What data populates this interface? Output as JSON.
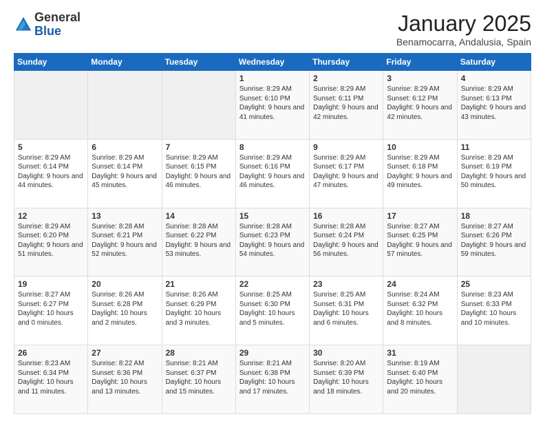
{
  "header": {
    "logo_general": "General",
    "logo_blue": "Blue",
    "month_title": "January 2025",
    "location": "Benamocarra, Andalusia, Spain"
  },
  "days_of_week": [
    "Sunday",
    "Monday",
    "Tuesday",
    "Wednesday",
    "Thursday",
    "Friday",
    "Saturday"
  ],
  "weeks": [
    [
      {
        "day": "",
        "text": ""
      },
      {
        "day": "",
        "text": ""
      },
      {
        "day": "",
        "text": ""
      },
      {
        "day": "1",
        "text": "Sunrise: 8:29 AM\nSunset: 6:10 PM\nDaylight: 9 hours\nand 41 minutes."
      },
      {
        "day": "2",
        "text": "Sunrise: 8:29 AM\nSunset: 6:11 PM\nDaylight: 9 hours\nand 42 minutes."
      },
      {
        "day": "3",
        "text": "Sunrise: 8:29 AM\nSunset: 6:12 PM\nDaylight: 9 hours\nand 42 minutes."
      },
      {
        "day": "4",
        "text": "Sunrise: 8:29 AM\nSunset: 6:13 PM\nDaylight: 9 hours\nand 43 minutes."
      }
    ],
    [
      {
        "day": "5",
        "text": "Sunrise: 8:29 AM\nSunset: 6:14 PM\nDaylight: 9 hours\nand 44 minutes."
      },
      {
        "day": "6",
        "text": "Sunrise: 8:29 AM\nSunset: 6:14 PM\nDaylight: 9 hours\nand 45 minutes."
      },
      {
        "day": "7",
        "text": "Sunrise: 8:29 AM\nSunset: 6:15 PM\nDaylight: 9 hours\nand 46 minutes."
      },
      {
        "day": "8",
        "text": "Sunrise: 8:29 AM\nSunset: 6:16 PM\nDaylight: 9 hours\nand 46 minutes."
      },
      {
        "day": "9",
        "text": "Sunrise: 8:29 AM\nSunset: 6:17 PM\nDaylight: 9 hours\nand 47 minutes."
      },
      {
        "day": "10",
        "text": "Sunrise: 8:29 AM\nSunset: 6:18 PM\nDaylight: 9 hours\nand 49 minutes."
      },
      {
        "day": "11",
        "text": "Sunrise: 8:29 AM\nSunset: 6:19 PM\nDaylight: 9 hours\nand 50 minutes."
      }
    ],
    [
      {
        "day": "12",
        "text": "Sunrise: 8:29 AM\nSunset: 6:20 PM\nDaylight: 9 hours\nand 51 minutes."
      },
      {
        "day": "13",
        "text": "Sunrise: 8:28 AM\nSunset: 6:21 PM\nDaylight: 9 hours\nand 52 minutes."
      },
      {
        "day": "14",
        "text": "Sunrise: 8:28 AM\nSunset: 6:22 PM\nDaylight: 9 hours\nand 53 minutes."
      },
      {
        "day": "15",
        "text": "Sunrise: 8:28 AM\nSunset: 6:23 PM\nDaylight: 9 hours\nand 54 minutes."
      },
      {
        "day": "16",
        "text": "Sunrise: 8:28 AM\nSunset: 6:24 PM\nDaylight: 9 hours\nand 56 minutes."
      },
      {
        "day": "17",
        "text": "Sunrise: 8:27 AM\nSunset: 6:25 PM\nDaylight: 9 hours\nand 57 minutes."
      },
      {
        "day": "18",
        "text": "Sunrise: 8:27 AM\nSunset: 6:26 PM\nDaylight: 9 hours\nand 59 minutes."
      }
    ],
    [
      {
        "day": "19",
        "text": "Sunrise: 8:27 AM\nSunset: 6:27 PM\nDaylight: 10 hours\nand 0 minutes."
      },
      {
        "day": "20",
        "text": "Sunrise: 8:26 AM\nSunset: 6:28 PM\nDaylight: 10 hours\nand 2 minutes."
      },
      {
        "day": "21",
        "text": "Sunrise: 8:26 AM\nSunset: 6:29 PM\nDaylight: 10 hours\nand 3 minutes."
      },
      {
        "day": "22",
        "text": "Sunrise: 8:25 AM\nSunset: 6:30 PM\nDaylight: 10 hours\nand 5 minutes."
      },
      {
        "day": "23",
        "text": "Sunrise: 8:25 AM\nSunset: 6:31 PM\nDaylight: 10 hours\nand 6 minutes."
      },
      {
        "day": "24",
        "text": "Sunrise: 8:24 AM\nSunset: 6:32 PM\nDaylight: 10 hours\nand 8 minutes."
      },
      {
        "day": "25",
        "text": "Sunrise: 8:23 AM\nSunset: 6:33 PM\nDaylight: 10 hours\nand 10 minutes."
      }
    ],
    [
      {
        "day": "26",
        "text": "Sunrise: 8:23 AM\nSunset: 6:34 PM\nDaylight: 10 hours\nand 11 minutes."
      },
      {
        "day": "27",
        "text": "Sunrise: 8:22 AM\nSunset: 6:36 PM\nDaylight: 10 hours\nand 13 minutes."
      },
      {
        "day": "28",
        "text": "Sunrise: 8:21 AM\nSunset: 6:37 PM\nDaylight: 10 hours\nand 15 minutes."
      },
      {
        "day": "29",
        "text": "Sunrise: 8:21 AM\nSunset: 6:38 PM\nDaylight: 10 hours\nand 17 minutes."
      },
      {
        "day": "30",
        "text": "Sunrise: 8:20 AM\nSunset: 6:39 PM\nDaylight: 10 hours\nand 18 minutes."
      },
      {
        "day": "31",
        "text": "Sunrise: 8:19 AM\nSunset: 6:40 PM\nDaylight: 10 hours\nand 20 minutes."
      },
      {
        "day": "",
        "text": ""
      }
    ]
  ]
}
